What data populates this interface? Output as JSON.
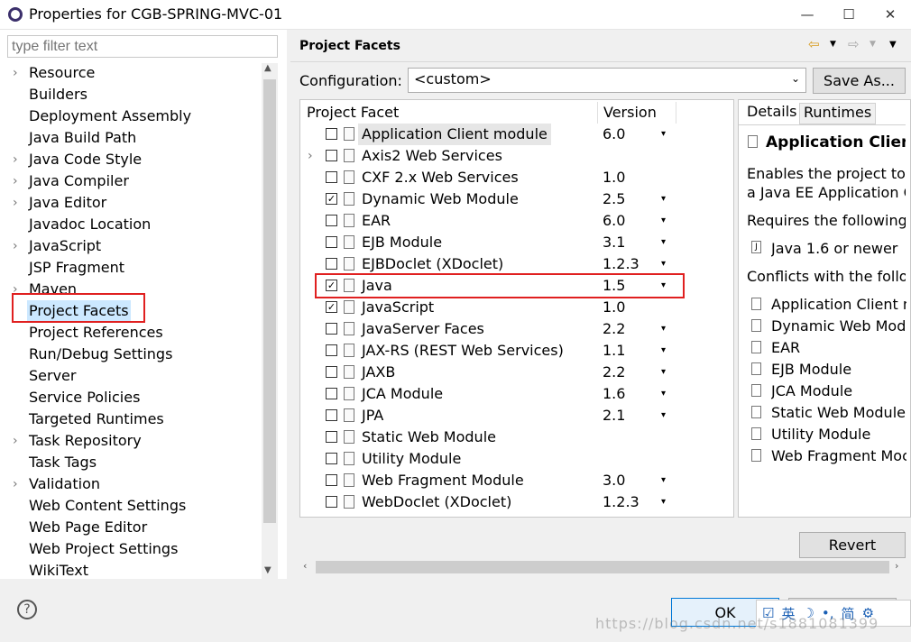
{
  "window": {
    "title": "Properties for CGB-SPRING-MVC-01"
  },
  "filter": {
    "placeholder": "type filter text"
  },
  "tree": [
    {
      "label": "Resource",
      "expandable": true
    },
    {
      "label": "Builders",
      "expandable": false
    },
    {
      "label": "Deployment Assembly",
      "expandable": false
    },
    {
      "label": "Java Build Path",
      "expandable": false
    },
    {
      "label": "Java Code Style",
      "expandable": true
    },
    {
      "label": "Java Compiler",
      "expandable": true
    },
    {
      "label": "Java Editor",
      "expandable": true
    },
    {
      "label": "Javadoc Location",
      "expandable": false
    },
    {
      "label": "JavaScript",
      "expandable": true
    },
    {
      "label": "JSP Fragment",
      "expandable": false
    },
    {
      "label": "Maven",
      "expandable": true
    },
    {
      "label": "Project Facets",
      "expandable": false,
      "selected": true
    },
    {
      "label": "Project References",
      "expandable": false
    },
    {
      "label": "Run/Debug Settings",
      "expandable": false
    },
    {
      "label": "Server",
      "expandable": false
    },
    {
      "label": "Service Policies",
      "expandable": false
    },
    {
      "label": "Targeted Runtimes",
      "expandable": false
    },
    {
      "label": "Task Repository",
      "expandable": true
    },
    {
      "label": "Task Tags",
      "expandable": false
    },
    {
      "label": "Validation",
      "expandable": true
    },
    {
      "label": "Web Content Settings",
      "expandable": false
    },
    {
      "label": "Web Page Editor",
      "expandable": false
    },
    {
      "label": "Web Project Settings",
      "expandable": false
    },
    {
      "label": "WikiText",
      "expandable": false
    }
  ],
  "page": {
    "title": "Project Facets",
    "config_label": "Configuration:",
    "config_value": "<custom>",
    "save_as": "Save As...",
    "col_facet": "Project Facet",
    "col_version": "Version",
    "revert": "Revert"
  },
  "facets": [
    {
      "name": "Application Client module",
      "version": "6.0",
      "checked": false,
      "dropdown": true,
      "highlight": true
    },
    {
      "name": "Axis2 Web Services",
      "version": "",
      "checked": false,
      "dropdown": false,
      "expandable": true
    },
    {
      "name": "CXF 2.x Web Services",
      "version": "1.0",
      "checked": false,
      "dropdown": false
    },
    {
      "name": "Dynamic Web Module",
      "version": "2.5",
      "checked": true,
      "dropdown": true
    },
    {
      "name": "EAR",
      "version": "6.0",
      "checked": false,
      "dropdown": true
    },
    {
      "name": "EJB Module",
      "version": "3.1",
      "checked": false,
      "dropdown": true
    },
    {
      "name": "EJBDoclet (XDoclet)",
      "version": "1.2.3",
      "checked": false,
      "dropdown": true
    },
    {
      "name": "Java",
      "version": "1.5",
      "checked": true,
      "dropdown": true
    },
    {
      "name": "JavaScript",
      "version": "1.0",
      "checked": true,
      "dropdown": false
    },
    {
      "name": "JavaServer Faces",
      "version": "2.2",
      "checked": false,
      "dropdown": true
    },
    {
      "name": "JAX-RS (REST Web Services)",
      "version": "1.1",
      "checked": false,
      "dropdown": true
    },
    {
      "name": "JAXB",
      "version": "2.2",
      "checked": false,
      "dropdown": true
    },
    {
      "name": "JCA Module",
      "version": "1.6",
      "checked": false,
      "dropdown": true
    },
    {
      "name": "JPA",
      "version": "2.1",
      "checked": false,
      "dropdown": true
    },
    {
      "name": "Static Web Module",
      "version": "",
      "checked": false,
      "dropdown": false
    },
    {
      "name": "Utility Module",
      "version": "",
      "checked": false,
      "dropdown": false
    },
    {
      "name": "Web Fragment Module",
      "version": "3.0",
      "checked": false,
      "dropdown": true
    },
    {
      "name": "WebDoclet (XDoclet)",
      "version": "1.2.3",
      "checked": false,
      "dropdown": true
    }
  ],
  "details": {
    "tab_details": "Details",
    "tab_runtimes": "Runtimes",
    "heading": "Application Client r",
    "desc1": "Enables the project to l",
    "desc2": "a Java EE Application C",
    "requires": "Requires the following",
    "req_item": "Java 1.6 or newer",
    "conflicts": "Conflicts with the follo",
    "conflict_items": [
      "Application Client m",
      "Dynamic Web Modu",
      "EAR",
      "EJB Module",
      "JCA Module",
      "Static Web Module",
      "Utility Module",
      "Web Fragment Moc"
    ]
  },
  "footer": {
    "ok": "OK",
    "help": "?",
    "ime_text": "英",
    "ime_simplified": "简",
    "watermark": "https://blog.csdn.net/s1881081399"
  },
  "colors": {
    "highlight_red": "#e02020",
    "selection": "#cce8ff"
  }
}
